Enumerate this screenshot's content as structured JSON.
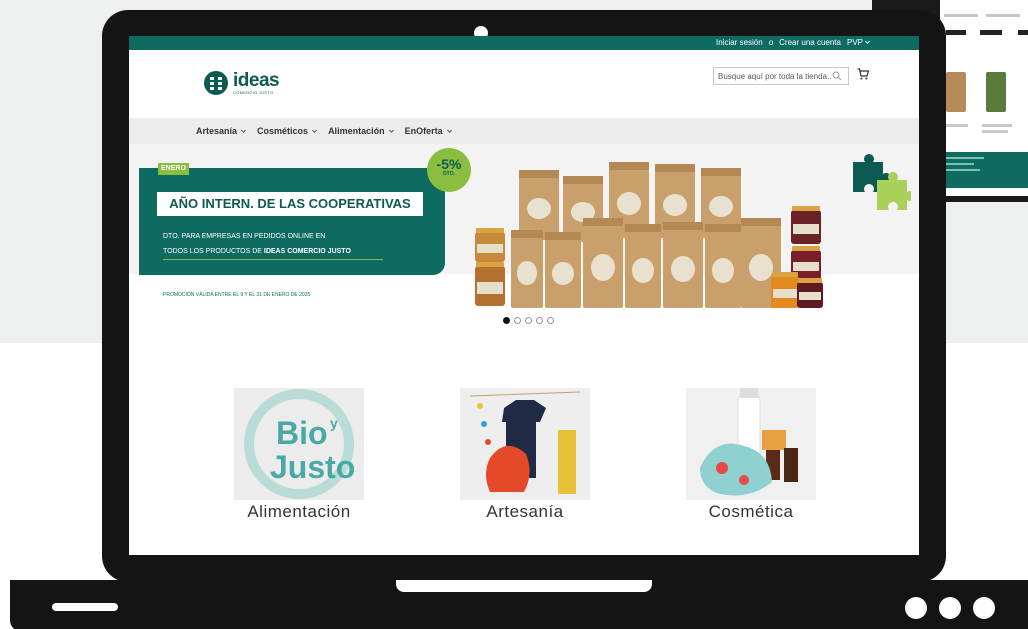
{
  "topbar": {
    "login": "Iniciar sesión",
    "separator": "o",
    "register": "Crear una cuenta",
    "price_mode": "PVP"
  },
  "logo": {
    "name": "ideas",
    "sub": "COMERCIO JUSTO"
  },
  "search": {
    "placeholder": "Busque aquí por toda la tienda..."
  },
  "nav": {
    "items": [
      {
        "label": "Artesanía"
      },
      {
        "label": "Cosméticos"
      },
      {
        "label": "Alimentación"
      },
      {
        "label": "EnOferta"
      }
    ]
  },
  "hero": {
    "badge_month": "ENERO",
    "title": "AÑO INTERN. DE LAS COOPERATIVAS",
    "line1": "DTO. PARA EMPRESAS EN PEDIDOS ONLINE EN",
    "line2_prefix": "TODOS LOS PRODUCTOS DE",
    "line2_brand": "IDEAS COMERCIO JUSTO",
    "promo": "PROMOCIÓN VÁLIDA ENTRE EL 9 Y EL 31 DE ENERO DE 2025",
    "discount": "-5%",
    "discount_sub": "DTO."
  },
  "carousel": {
    "slides": 5,
    "active": 1
  },
  "categories": [
    {
      "label": "Alimentación",
      "logo_text_1": "Bio",
      "logo_text_2": "y",
      "logo_text_3": "Justo"
    },
    {
      "label": "Artesanía"
    },
    {
      "label": "Cosmética"
    }
  ],
  "colors": {
    "brand": "#0d6b62",
    "accent": "#8bbd3f",
    "device": "#141414"
  }
}
